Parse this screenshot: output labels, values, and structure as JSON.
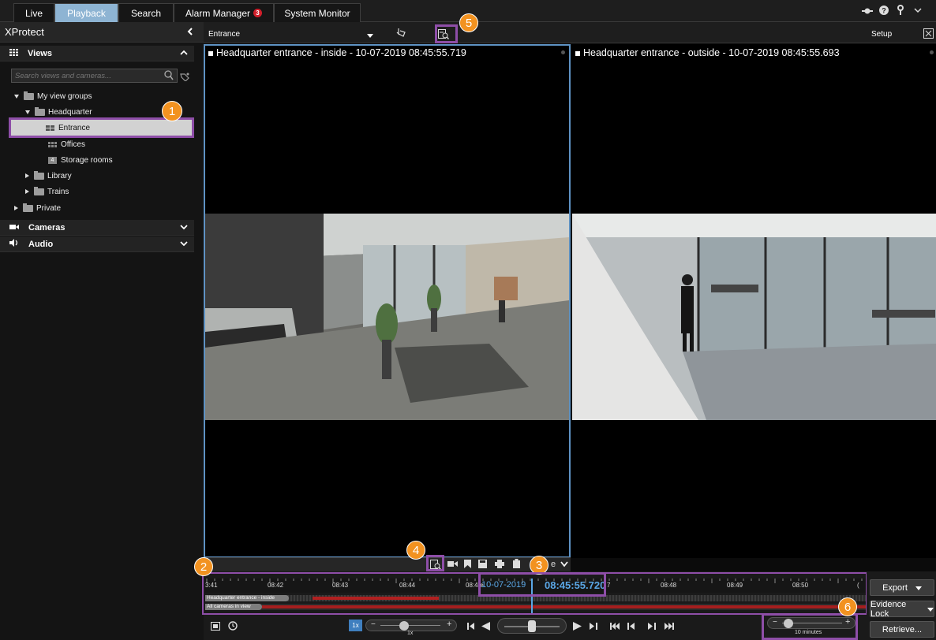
{
  "tabs": [
    {
      "label": "Live"
    },
    {
      "label": "Playback"
    },
    {
      "label": "Search"
    },
    {
      "label": "Alarm Manager",
      "badge": "3"
    },
    {
      "label": "System Monitor"
    }
  ],
  "sidebar": {
    "title": "XProtect",
    "views_header": "Views",
    "search_placeholder": "Search views and cameras...",
    "tree": {
      "my_view_groups": "My view groups",
      "headquarter": "Headquarter",
      "entrance": "Entrance",
      "offices": "Offices",
      "storage_badge": "4",
      "storage_rooms": "Storage rooms",
      "library": "Library",
      "trains": "Trains",
      "private": "Private"
    },
    "cameras_header": "Cameras",
    "audio_header": "Audio"
  },
  "view_toolbar": {
    "view_name": "Entrance",
    "setup_label": "Setup"
  },
  "tiles": [
    {
      "title": "Headquarter entrance - inside - 10-07-2019 08:45:55.719"
    },
    {
      "title": "Headquarter entrance - outside - 10-07-2019 08:45:55.693"
    }
  ],
  "tile_toolbar": {
    "trailing_label": "e"
  },
  "timeline": {
    "ticks": [
      "3:41",
      "08:42",
      "08:43",
      "08:44",
      "08:4æ",
      "7",
      "08:48",
      "08:49",
      "08:50",
      "("
    ],
    "tracks": [
      "Headquarter entrance - inside",
      "All cameras in view"
    ],
    "date": "10-07-2019",
    "time": "08:45:55.720",
    "speed_button": "1x",
    "speed_label": "1x",
    "span_label": "10 minutes",
    "minus": "−",
    "plus": "+"
  },
  "actions": {
    "export": "Export",
    "evidence_lock": "Evidence Lock",
    "retrieve": "Retrieve..."
  },
  "callouts": [
    "1",
    "2",
    "3",
    "4",
    "5",
    "6"
  ],
  "colors": {
    "accent": "#8eb4d3",
    "callout": "#f29220",
    "highlight": "#8e4ea8",
    "recording": "#c02020",
    "time": "#5aa7e6"
  }
}
